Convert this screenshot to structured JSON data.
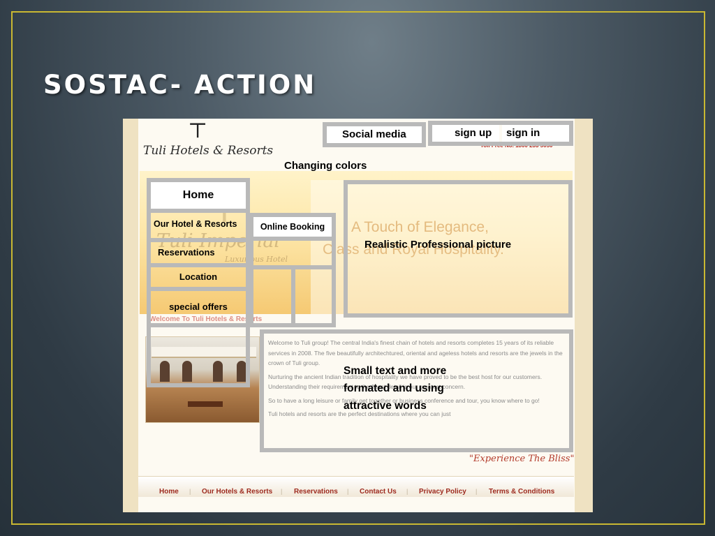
{
  "slide": {
    "title": "SOSTAC- ACTION"
  },
  "site": {
    "logo_text": "Tuli Hotels & Resorts",
    "toll_free": "Toll Free No. 1800 233 5050",
    "banner_script": "Tuli Imperial",
    "banner_sub": "Luxurious Hotel",
    "tagline_line1": "A Touch of Elegance,",
    "tagline_line2": "Class and Royal Hospitality.",
    "welcome_heading": "Welcome To Tuli Hotels & Resorts",
    "body_paragraphs": [
      "Welcome to Tuli group! The central India's finest chain of hotels and resorts completes 15 years of its reliable services in 2008. The five beautifully architechtured, oriental and ageless hotels and resorts are the jewels in the crown of Tuli group.",
      "Nurturing the ancient Indian tradition of hospitality we have proved to be the best host for our customers. Understanding their requirement to the finest detail is our greatest concern.",
      "So to have a long leisure or family get together or business conference and tour, you know where to go!",
      "Tuli hotels and resorts are the perfect destinations where you can just"
    ],
    "tagline_footer": "\"Experience The Bliss\"",
    "footer_nav": [
      "Home",
      "Our Hotels & Resorts",
      "Reservations",
      "Contact Us",
      "Privacy Policy",
      "Terms & Conditions"
    ]
  },
  "annotations": {
    "social_media": "Social media",
    "sign_up": "sign up",
    "sign_in": "sign in",
    "changing_colors": "Changing colors",
    "menu": [
      "Home",
      "Our Hotel & Resorts",
      "Reservations",
      "Location",
      "special offers"
    ],
    "online_booking": "Online Booking",
    "realistic_picture": "Realistic Professional picture",
    "small_text": [
      "Small text and more",
      "formated and using",
      "attractive words"
    ]
  },
  "colors": {
    "frame_border": "#c9b832",
    "annotation_border": "#b9b9b9",
    "footer_link": "#9d2a1e"
  }
}
